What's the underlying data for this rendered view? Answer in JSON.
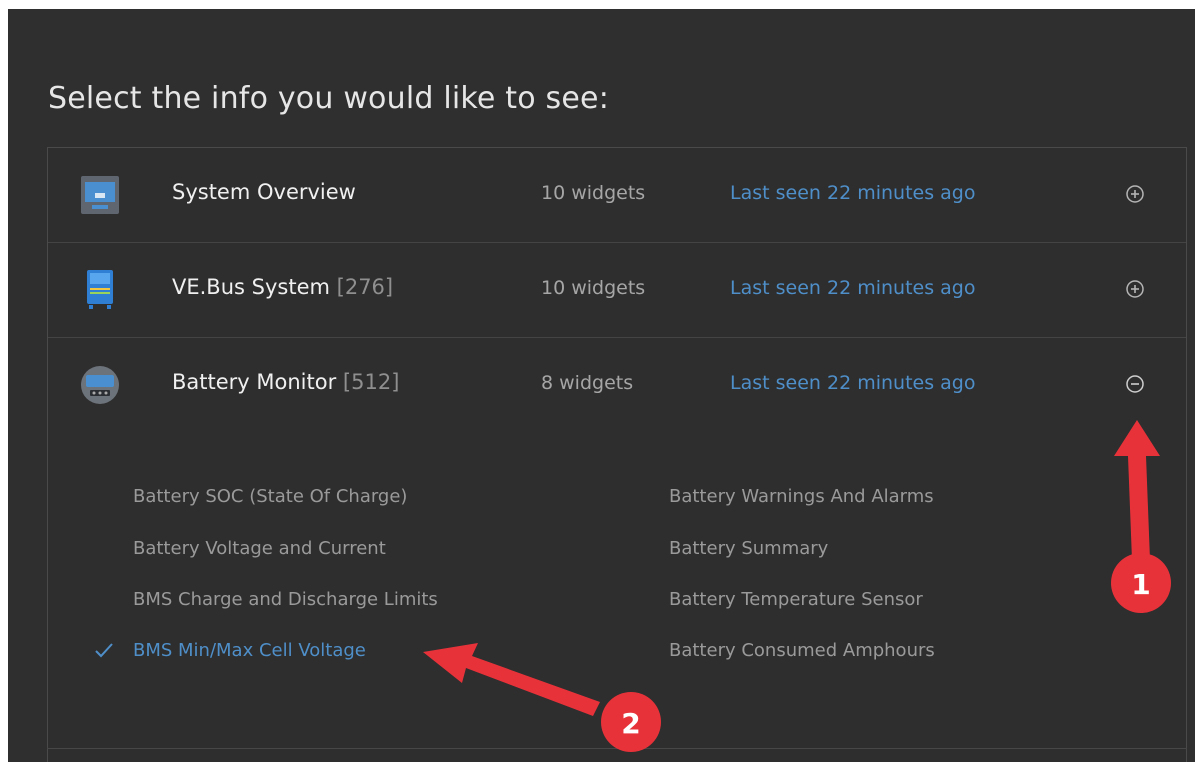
{
  "heading": "Select the info you would like to see:",
  "devices": [
    {
      "name": "System Overview",
      "id": "",
      "widgets": "10 widgets",
      "last_seen": "Last seen 22 minutes ago",
      "toggle_icon": "plus-circle-icon",
      "expanded": false
    },
    {
      "name": "VE.Bus System",
      "id": "[276]",
      "widgets": "10 widgets",
      "last_seen": "Last seen 22 minutes ago",
      "toggle_icon": "plus-circle-icon",
      "expanded": false
    },
    {
      "name": "Battery Monitor",
      "id": "[512]",
      "widgets": "8 widgets",
      "last_seen": "Last seen 22 minutes ago",
      "toggle_icon": "minus-circle-icon",
      "expanded": true
    }
  ],
  "widget_options": {
    "left": [
      {
        "label": "Battery SOC (State Of Charge)",
        "selected": false
      },
      {
        "label": "Battery Voltage and Current",
        "selected": false
      },
      {
        "label": "BMS Charge and Discharge Limits",
        "selected": false
      },
      {
        "label": "BMS Min/Max Cell Voltage",
        "selected": true
      }
    ],
    "right": [
      {
        "label": "Battery Warnings And Alarms",
        "selected": false
      },
      {
        "label": "Battery Summary",
        "selected": false
      },
      {
        "label": "Battery Temperature Sensor",
        "selected": false
      },
      {
        "label": "Battery Consumed Amphours",
        "selected": false
      }
    ]
  },
  "annotations": {
    "badge1": "1",
    "badge2": "2"
  },
  "colors": {
    "panel": "#2f2f2f",
    "link_blue": "#4f8fc9",
    "annotation_red": "#e8323a"
  }
}
